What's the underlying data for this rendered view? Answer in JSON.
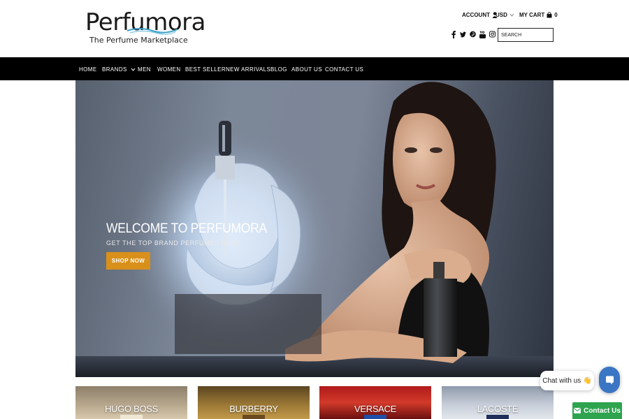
{
  "brand": {
    "name": "Perfumora",
    "tagline": "The Perfume Marketplace"
  },
  "utility": {
    "account_label": "ACCOUNT",
    "currency": "USD",
    "cart_label": "MY CART",
    "cart_count": "0"
  },
  "socials": [
    "facebook-icon",
    "twitter-icon",
    "pinterest-icon",
    "youtube-icon",
    "instagram-icon"
  ],
  "search": {
    "placeholder": "SEARCH"
  },
  "nav": {
    "items": [
      "HOME",
      "BRANDS",
      "MEN",
      "WOMEN",
      "BEST SELLER",
      "NEW ARRIVALS",
      "BLOG",
      "ABOUT US",
      "CONTACT US"
    ]
  },
  "hero": {
    "title": "WELCOME TO PERFUMORA",
    "subtitle": "GET THE TOP BRAND PERFUMES HERE",
    "cta": "SHOP NOW"
  },
  "tiles": [
    "HUGO BOSS",
    "BURBERRY",
    "VERSACE",
    "LACOSTE"
  ],
  "chat": {
    "label": "Chat with us",
    "emoji": "👋",
    "contact_label": "Contact Us"
  },
  "colors": {
    "accent": "#d8901b",
    "nav_bg": "#000000",
    "chat_blue": "#3b76c4",
    "contact_green": "#2ea44f",
    "logo_wave": "#3aa0c8"
  }
}
